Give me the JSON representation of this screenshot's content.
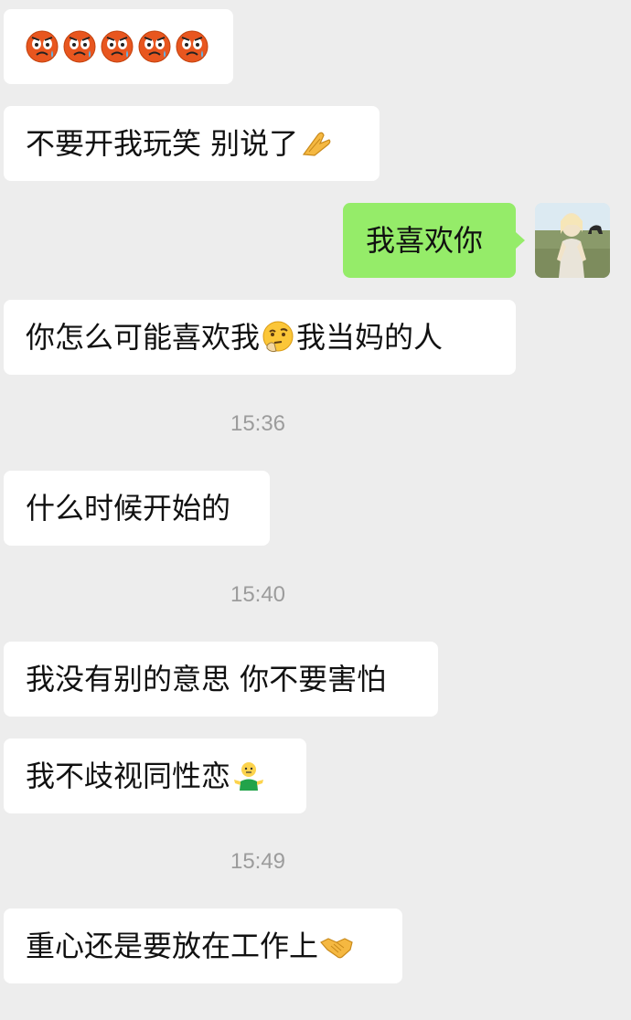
{
  "messages": [
    {
      "id": "m1",
      "direction": "received",
      "text": "",
      "emojis": [
        "weary-face-icon",
        "weary-face-icon",
        "weary-face-icon",
        "weary-face-icon",
        "weary-face-icon"
      ]
    },
    {
      "id": "m2",
      "direction": "received",
      "text": "不要开我玩笑 别说了",
      "emojis": [
        "folded-hands-icon"
      ]
    },
    {
      "id": "m3",
      "direction": "sent",
      "text": "我喜欢你"
    },
    {
      "id": "m4",
      "direction": "received",
      "text_before": "你怎么可能喜欢我",
      "emoji": "thinking-face-icon",
      "text_after": "我当妈的人"
    },
    {
      "id": "t1",
      "type": "timestamp",
      "text": "15:36"
    },
    {
      "id": "m5",
      "direction": "received",
      "text": "什么时候开始的"
    },
    {
      "id": "t2",
      "type": "timestamp",
      "text": "15:40"
    },
    {
      "id": "m6",
      "direction": "received",
      "text": "我没有别的意思 你不要害怕"
    },
    {
      "id": "m7",
      "direction": "received",
      "text": "我不歧视同性恋",
      "emojis": [
        "shrug-person-icon"
      ]
    },
    {
      "id": "t3",
      "type": "timestamp",
      "text": "15:49"
    },
    {
      "id": "m8",
      "direction": "received",
      "text": "重心还是要放在工作上",
      "emojis": [
        "handshake-icon"
      ]
    }
  ],
  "colors": {
    "background": "#ededed",
    "received_bubble": "#ffffff",
    "sent_bubble": "#95ec69",
    "timestamp_text": "#9c9c9c"
  },
  "avatar": {
    "icon": "user-avatar-photo"
  }
}
